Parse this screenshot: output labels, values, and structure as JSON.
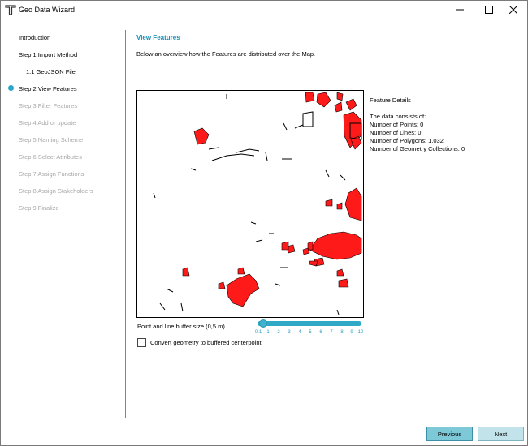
{
  "window": {
    "title": "Geo Data Wizard",
    "icon": "tygron-logo-icon",
    "controls": [
      "minimize-icon",
      "maximize-icon",
      "close-icon"
    ]
  },
  "sidebar": {
    "items": [
      {
        "label": "Introduction",
        "state": "done"
      },
      {
        "label": "Step 1 Import Method",
        "state": "done"
      },
      {
        "label": "1.1 GeoJSON File",
        "state": "done",
        "sub": true
      },
      {
        "label": "Step 2 View Features",
        "state": "current"
      },
      {
        "label": "Step 3 Filter Features",
        "state": "disabled"
      },
      {
        "label": "Step 4 Add or update",
        "state": "disabled"
      },
      {
        "label": "Step 5 Naming Scheme",
        "state": "disabled"
      },
      {
        "label": "Step 6 Select Attributes",
        "state": "disabled"
      },
      {
        "label": "Step 7 Assign Functions",
        "state": "disabled"
      },
      {
        "label": "Step 8 Assign Stakeholders",
        "state": "disabled"
      },
      {
        "label": "Step 9 Finalize",
        "state": "disabled"
      }
    ]
  },
  "main": {
    "title": "View Features",
    "description": "Below an overview how the Features are distributed over the Map.",
    "details": {
      "heading": "Feature Details",
      "intro": "The data consists of:",
      "points": "Number of Points: 0",
      "lines": "Number of Lines: 0",
      "polygons": "Number of Polygons: 1.032",
      "collections": "Number of Geometry Collections: 0"
    },
    "slider": {
      "label": "Point and line buffer size (0,5 m)",
      "value": 0.5,
      "ticks": [
        "0.1",
        "1",
        "2",
        "3",
        "4",
        "5",
        "6",
        "7",
        "8",
        "9",
        "10"
      ]
    },
    "checkbox": {
      "label": "Convert geometry to buffered centerpoint",
      "checked": false
    }
  },
  "footer": {
    "previous": "Previous",
    "next": "Next"
  },
  "colors": {
    "accent": "#2aa5c4",
    "feature_fill": "#ff1a1a",
    "feature_stroke": "#000000"
  }
}
